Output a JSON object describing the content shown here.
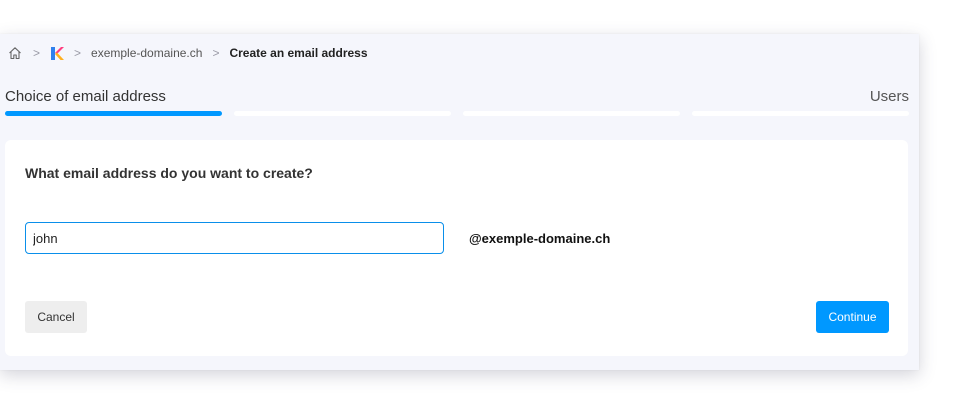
{
  "breadcrumb": {
    "home_icon": "home-icon",
    "logo_icon": "brand-logo-icon",
    "separator": ">",
    "domain": "exemple-domaine.ch",
    "current": "Create an email address"
  },
  "steps": {
    "current_title": "Choice of email address",
    "last_title": "Users",
    "total": 4,
    "active_index": 1
  },
  "form": {
    "question": "What email address do you want to create?",
    "email_value": "john",
    "domain_suffix": "@exemple-domaine.ch",
    "cancel_label": "Cancel",
    "continue_label": "Continue"
  },
  "colors": {
    "accent": "#0098ff",
    "background": "#f5f6fc"
  }
}
